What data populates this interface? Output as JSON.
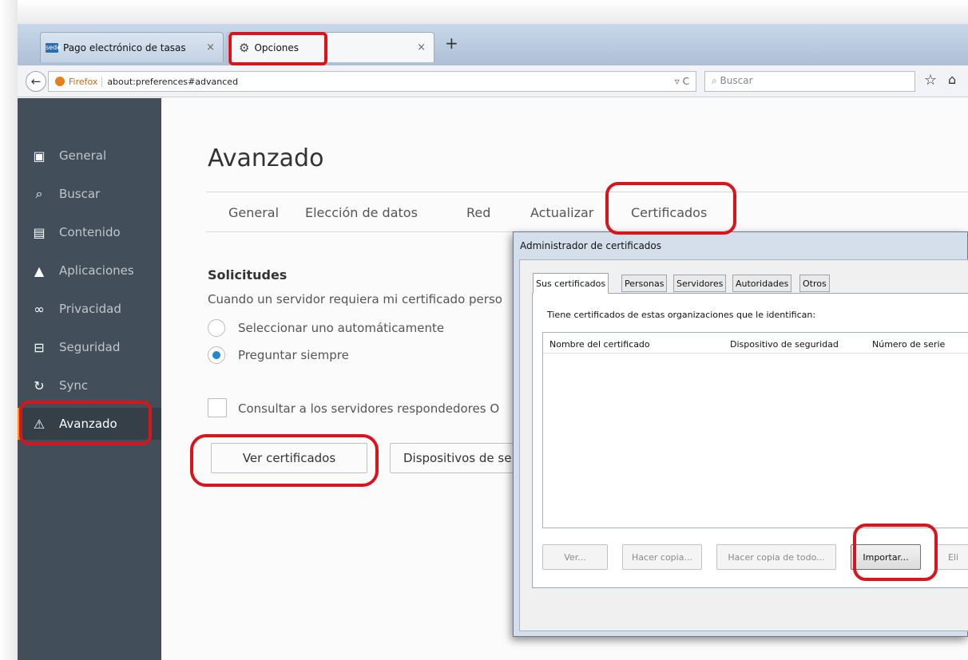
{
  "browser": {
    "tabs": [
      {
        "title": "Pago electrónico de tasas",
        "favicon": "sede-favicon",
        "close": "×"
      },
      {
        "title": "Opciones",
        "icon": "gear-icon",
        "close": "×"
      }
    ],
    "new_tab": "+",
    "back": "←",
    "identity_label": "Firefox",
    "url": "about:preferences#advanced",
    "url_controls": "▿ C",
    "search_placeholder": "Buscar",
    "bookmark": "☆",
    "library": "⌂"
  },
  "sidebar": {
    "items": [
      {
        "label": "General",
        "icon": "general-icon",
        "glyph": "▣"
      },
      {
        "label": "Buscar",
        "icon": "search-icon",
        "glyph": "⌕"
      },
      {
        "label": "Contenido",
        "icon": "content-icon",
        "glyph": "▤"
      },
      {
        "label": "Aplicaciones",
        "icon": "applications-icon",
        "glyph": "▲"
      },
      {
        "label": "Privacidad",
        "icon": "privacy-icon",
        "glyph": "∞"
      },
      {
        "label": "Seguridad",
        "icon": "lock-icon",
        "glyph": "⊟"
      },
      {
        "label": "Sync",
        "icon": "sync-icon",
        "glyph": "↻"
      },
      {
        "label": "Avanzado",
        "icon": "advanced-icon",
        "glyph": "⚠"
      }
    ],
    "active": "Avanzado"
  },
  "main": {
    "title": "Avanzado",
    "tabs": [
      "General",
      "Elección de datos",
      "Red",
      "Actualizar",
      "Certificados"
    ],
    "active_tab": "Certificados",
    "section_title": "Solicitudes",
    "description": "Cuando un servidor requiera mi certificado perso",
    "radio_auto": "Seleccionar uno automáticamente",
    "radio_ask": "Preguntar siempre",
    "ocsp_label": "Consultar a los servidores respondedores O",
    "view_certs_button": "Ver certificados",
    "devices_button": "Dispositivos de se"
  },
  "dialog": {
    "title": "Administrador de certificados",
    "tabs": [
      "Sus certificados",
      "Personas",
      "Servidores",
      "Autoridades",
      "Otros"
    ],
    "active_tab": "Sus certificados",
    "description": "Tiene certificados de estas organizaciones que le identifican:",
    "columns": [
      "Nombre del certificado",
      "Dispositivo de seguridad",
      "Número de serie"
    ],
    "buttons": {
      "view": "Ver...",
      "backup": "Hacer copia...",
      "backup_all": "Hacer copia de todo...",
      "import": "Importar...",
      "delete": "Eli"
    }
  },
  "colors": {
    "sidebar_bg": "#424f5a",
    "accent": "#ff9500",
    "highlight_marks": "#d8141c",
    "radio_checked": "#1e88d0"
  }
}
